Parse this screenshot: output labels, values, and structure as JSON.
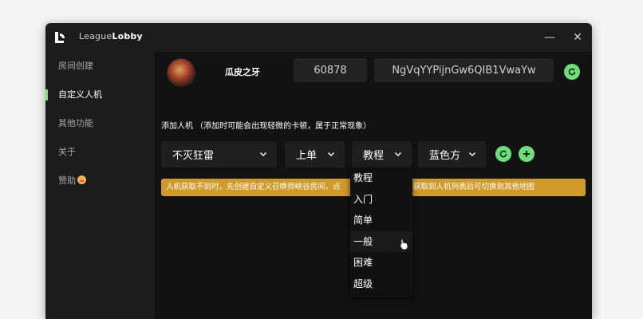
{
  "app": {
    "title_prefix": "League",
    "title_bold": "Lobby",
    "minimize_symbol": "—",
    "close_symbol": "✕"
  },
  "sidebar": {
    "items": [
      {
        "label": "房间创建",
        "active": false
      },
      {
        "label": "自定义人机",
        "active": true
      },
      {
        "label": "其他功能",
        "active": false
      },
      {
        "label": "关于",
        "active": false
      },
      {
        "label": "赞助",
        "active": false
      }
    ]
  },
  "header": {
    "summoner_name": "瓜皮之牙",
    "room_number": "60878",
    "room_code": "NgVqYYPijnGw6QIB1VwaYw"
  },
  "bots": {
    "hint": "添加人机 （添加时可能会出现轻微的卡顿，属于正常现象）",
    "champion": "不灭狂雷",
    "lane": "上单",
    "difficulty": "教程",
    "team": "蓝色方",
    "difficulty_options": [
      "教程",
      "入门",
      "简单",
      "一般",
      "困难",
      "超级"
    ]
  },
  "banner": {
    "text_left": "人机获取不到时，先创建自定义召唤师峡谷房间，点",
    "text_right": "获取到人机列表后可切换到其他地图"
  },
  "colors": {
    "accent": "#6fde7a",
    "banner": "#d19a2a",
    "window_bg": "#1c1c1c",
    "main_bg": "#121212"
  }
}
